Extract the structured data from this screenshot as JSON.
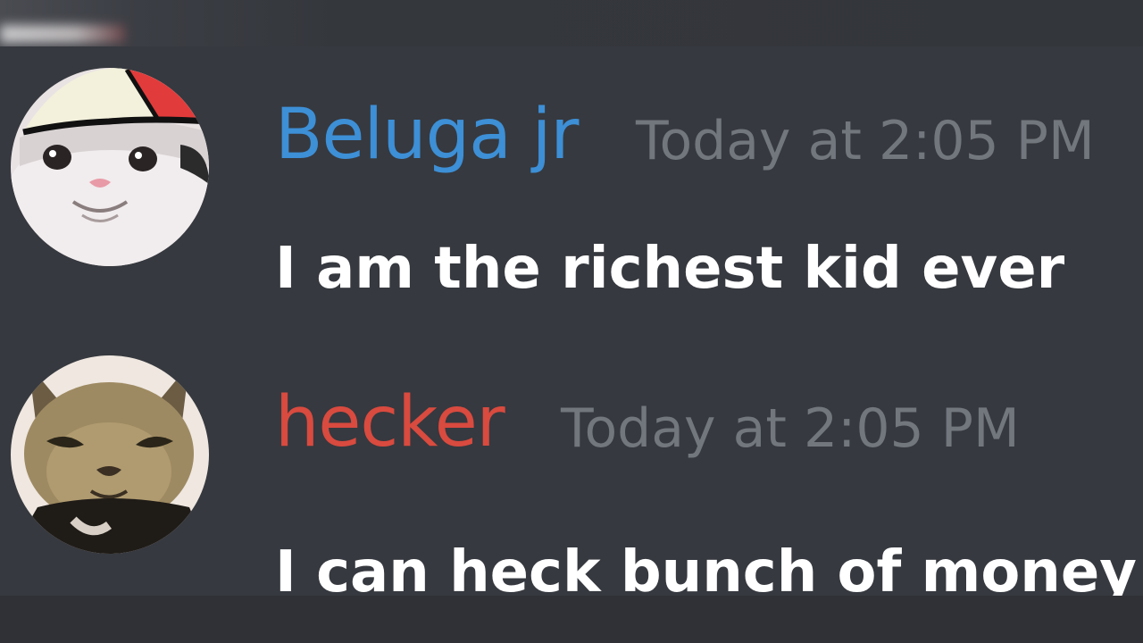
{
  "messages": [
    {
      "username": "Beluga jr",
      "timestamp": "Today at 2:05 PM",
      "content": "I am the richest kid ever",
      "username_color": "#3d8fd6",
      "avatar_icon": "beluga-cat-avatar-icon"
    },
    {
      "username": "hecker",
      "timestamp": "Today at 2:05 PM",
      "content": "I can heck bunch of money",
      "username_color": "#d94a3f",
      "avatar_icon": "caracal-cat-avatar-icon"
    }
  ],
  "theme": {
    "background": "#36393f",
    "timestamp_color": "#72767d",
    "text_color": "#ffffff"
  }
}
